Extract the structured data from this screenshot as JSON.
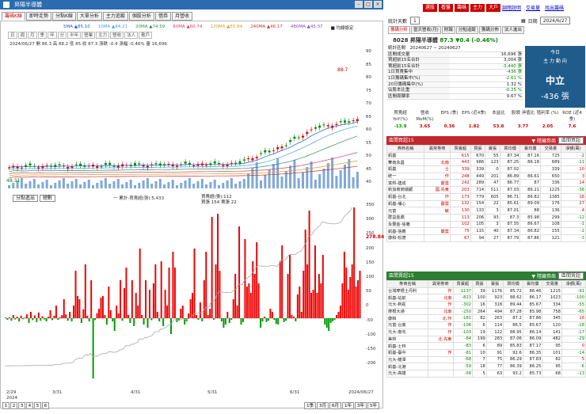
{
  "window": {
    "title": "昇陽半導體"
  },
  "chart_tabs": [
    "籌碼K線",
    "即時走勢",
    "分點K線",
    "大單分析",
    "主力追蹤",
    "個股分析",
    "借券",
    "月營收"
  ],
  "chart_toolbar": [
    "日",
    "週",
    "月",
    "季",
    "年",
    "分",
    "半年",
    "營業",
    "主力",
    "營收",
    "法人",
    "散戶"
  ],
  "ma": [
    {
      "label": "5MA",
      "value": "▲85.10",
      "color": "#2255cc"
    },
    {
      "label": "10MA",
      "value": "▲84.21",
      "color": "#4aa0d8"
    },
    {
      "label": "20MA",
      "value": "▲74.59",
      "color": "#2e8b57"
    },
    {
      "label": "60MA",
      "value": "▲60.74",
      "color": "#d04070"
    },
    {
      "label": "120MA",
      "value": "▲55.84",
      "color": "#d0a020"
    },
    {
      "label": "240MA",
      "value": "▲46.17",
      "color": "#cc3333"
    },
    {
      "label": "480MA",
      "value": "▲45.37",
      "color": "#8844cc"
    }
  ],
  "ma_note": "■ 均線設定",
  "price_info": "2024/06/27 開 86.3 高 88.2 低 85 收 87.3 漲跌 -0.4 漲幅 -0.46% 量 16,696",
  "price_info2": "元",
  "price_axis": [
    "90",
    "85",
    "80",
    "75",
    "70",
    "65",
    "60",
    "55",
    "50",
    "45",
    "40"
  ],
  "price_labels": {
    "high": "88.7",
    "low": "48.31"
  },
  "chip_axis": [
    "350",
    "300",
    "250",
    "200",
    "150",
    "100",
    "50",
    "0",
    "-50",
    "-100",
    "-150",
    "-200"
  ],
  "chip_select": "分點進出",
  "chip_select2": "總數",
  "chip_legend": "一 累計-買賣超(張):5,433",
  "chip_buy": "買賣超(張):112",
  "chip_sell": "買張 154 賣張 22",
  "chip_cum": "278.84",
  "x_labels": [
    {
      "t": "2/29",
      "t2": "2024"
    },
    {
      "t": "3/31",
      "t2": ""
    },
    {
      "t": "4/31",
      "t2": ""
    },
    {
      "t": "5/31",
      "t2": ""
    },
    {
      "t": "6/31",
      "t2": ""
    },
    {
      "t": "2024/06/27",
      "t2": ""
    }
  ],
  "bottom_pages": [
    "1",
    "2",
    "3",
    "4",
    "5",
    "6"
  ],
  "range_buttons": [
    "1季",
    "3月",
    "6月",
    "1年",
    "3年",
    "5年"
  ],
  "top_buttons": [
    "選股",
    "看盤",
    "籌碼",
    "主力",
    "大戶"
  ],
  "top_links": [
    "調閱說明",
    "交易量",
    "找出籌碼"
  ],
  "stat_days_label": "統計天數",
  "stat_days": "1",
  "date_label": "日期",
  "date": "2024/6/27",
  "sub_tabs": [
    "籌碼分析",
    "當天營收(月)",
    "財報",
    "分點追蹤",
    "籌碼分佈",
    "法人進出"
  ],
  "stock": {
    "code": "8028 昇陽半導體",
    "price": "87.3",
    "change": "▼0.4 (-0.46%)"
  },
  "summary_range": "統計區間　20240627 ~ 20240627",
  "summary": [
    {
      "k": "區間成交量",
      "v": "16,696 張"
    },
    {
      "k": "買超前15名合計",
      "v": "3,004 張"
    },
    {
      "k": "賣超前15名合計",
      "v": "-3,440 張"
    },
    {
      "k": "1日買賣集中",
      "v": "-436 張"
    },
    {
      "k": "1日籌碼集中(%)",
      "v": "-2.61 %"
    },
    {
      "k": "20日籌碼集中(%)",
      "v": "1.32 %"
    },
    {
      "k": "佔股本比重",
      "v": "-0.25 %"
    },
    {
      "k": "區間周轉率",
      "v": "9.67 %"
    }
  ],
  "today": {
    "t1": "今日",
    "t2": "主 力 動 向",
    "t3": "中立",
    "t4": "-436 張"
  },
  "metrics_h": [
    "買賣超 YoY(%)",
    "營收 MoM(%)",
    "EPS (季)",
    "EPS (近4季)",
    "本益比",
    "股價 淨值比",
    "殖利率 (%)",
    "ROE (近4季)"
  ],
  "metrics_v": [
    "-13.9",
    "3.65",
    "0.36",
    "1.82",
    "53.8",
    "3.77",
    "2.05",
    "7.6"
  ],
  "buy_hdr": "區間買超15",
  "buy_sel": "區間買超",
  "sell_hdr": "區間賣超15",
  "sell_sel": "區間賣超",
  "cols": [
    "券商名稱",
    "異常券商",
    "買賣超",
    "買張",
    "賣張",
    "買均價",
    "賣均價",
    "交易量",
    "淨額(萬)"
  ],
  "buy_rows": [
    [
      "凱基",
      "",
      "615",
      "670",
      "55",
      "87.34",
      "87.16",
      "725",
      "-2"
    ],
    [
      "華南永昌",
      "北南",
      "443",
      "986",
      "123",
      "87.25",
      "86.18",
      "689",
      "-11"
    ],
    [
      "凱基",
      "士",
      "339",
      "339",
      "0",
      "87.02",
      "",
      "339",
      "10"
    ],
    [
      "統一",
      "作",
      "248",
      "449",
      "201",
      "86.89",
      "86.61",
      "650",
      "3"
    ],
    [
      "富邦-建成",
      "慶雲",
      "242",
      "289",
      "47",
      "86.77",
      "87",
      "336",
      "14"
    ],
    [
      "新加坡商瑞銀",
      "國.先東",
      "203",
      "714",
      "511",
      "87.03",
      "86.21",
      "1225",
      "-36"
    ],
    [
      "凱基-台北",
      "作",
      "173",
      "779",
      "605",
      "86.71",
      "86.82",
      "1385",
      "16"
    ],
    [
      "凱基-埔心",
      "慶雲",
      "132",
      "154",
      "22",
      "85.61",
      "89.09",
      "176",
      "27"
    ],
    [
      "元富",
      "敏",
      "130",
      "133",
      "3",
      "87.01",
      "88",
      "136",
      "4"
    ],
    [
      "群益金鼎",
      "",
      "113",
      "206",
      "93",
      "87.3",
      "85.98",
      "299",
      "-12"
    ],
    [
      "永豐金-信義",
      "",
      "102",
      "105",
      "3",
      "87.55",
      "86.67",
      "108",
      "-1"
    ],
    [
      "凱基-信義",
      "慶雲",
      "75",
      "115",
      "40",
      "87.34",
      "86.82",
      "155",
      "-2"
    ],
    [
      "康和-松德",
      "",
      "67",
      "94",
      "27",
      "87.79",
      "87.86",
      "121",
      "-3"
    ]
  ],
  "sell_rows": [
    [
      "台灣摩根士丹利",
      "作",
      "-1137",
      "39",
      "1176",
      "85.72",
      "86.46",
      "1215",
      "-91"
    ],
    [
      "凱基-站前",
      "北南",
      "-823",
      "100",
      "923",
      "88.62",
      "86.17",
      "1023",
      "-100"
    ],
    [
      "元大-新莊",
      "作",
      "-302",
      "16",
      "318",
      "89.44",
      "85.67",
      "334",
      "-55"
    ],
    [
      "摩根大通",
      "北南",
      "-250",
      "264",
      "494",
      "87.28",
      "85.98",
      "758",
      "-65"
    ],
    [
      "康和",
      "北.作",
      "-181",
      "82",
      "263",
      "87.2",
      "87.86",
      "345",
      "16"
    ],
    [
      "元富-台南",
      "作",
      "-108",
      "6",
      "114",
      "86.5",
      "85.67",
      "120",
      "-18"
    ],
    [
      "元大-南屯",
      "作",
      "-103",
      "19",
      "122",
      "88.95",
      "86.14",
      "141",
      "-17"
    ],
    [
      "美林",
      "北.先東",
      "-84",
      "199",
      "283",
      "87.06",
      "86.09",
      "482",
      "-29"
    ],
    [
      "凱基-士林",
      "",
      "-83",
      "6",
      "89",
      "85.83",
      "87.17",
      "95",
      "0"
    ],
    [
      "凱基-臺中",
      "作",
      "-81",
      "10",
      "91",
      "92.6",
      "86.35",
      "101",
      "-14"
    ],
    [
      "元大-龍潭",
      "",
      "-68",
      "7",
      "75",
      "86.29",
      "87.83",
      "82",
      "5"
    ],
    [
      "凱基-北港",
      "",
      "-59",
      "18",
      "77",
      "86.39",
      "86.25",
      "95",
      "-6"
    ],
    [
      "元大-高雄",
      "",
      "-58",
      "5",
      "63",
      "93.2",
      "85.73",
      "68",
      "-13"
    ]
  ],
  "chart_data": {
    "type": "bar",
    "title": "",
    "x": [
      "2/29",
      "3/31",
      "4/31",
      "5/31",
      "6/31",
      "2024/06/27"
    ],
    "ylim": [
      -200,
      350
    ],
    "series": [
      {
        "name": "買賣超(張)",
        "values": [
          2,
          -5,
          3,
          -8,
          10,
          -4,
          5,
          -10,
          8,
          -3,
          2,
          12,
          -15,
          20,
          -6,
          9,
          -12,
          18,
          -8,
          6,
          -4,
          -10,
          5,
          25,
          -6,
          8,
          40,
          -5,
          3,
          10,
          60,
          12,
          -8,
          20,
          -10,
          40,
          150,
          70,
          60,
          -15,
          28,
          170,
          8,
          -10,
          120,
          -190,
          -6,
          16,
          30,
          65,
          70,
          10,
          -20,
          100,
          25,
          -10,
          -40,
          40,
          15,
          120,
          -8,
          95,
          160,
          10,
          -15,
          120,
          -25,
          80,
          40,
          220,
          10,
          -20,
          120,
          -30,
          90,
          -6,
          110,
          170,
          20,
          -10,
          180,
          -25,
          90,
          40,
          160,
          -50,
          210,
          160,
          -12,
          -8,
          30,
          40,
          -20,
          -10,
          15,
          60,
          80,
          220,
          10,
          -5,
          50,
          -10,
          120,
          210,
          10,
          30,
          320,
          -5,
          170,
          330,
          150,
          -10,
          -30,
          -20,
          20,
          -15,
          -5,
          60,
          140,
          40,
          290,
          -20,
          -12,
          250,
          100,
          110,
          80,
          180,
          140,
          240,
          110,
          -30,
          -10,
          5,
          -12,
          -8,
          30,
          20,
          -5,
          -18,
          -20,
          180,
          230,
          -12,
          -8,
          140,
          200,
          10,
          5,
          -10,
          75,
          100,
          20,
          150,
          280,
          170,
          340,
          80,
          90,
          230,
          80,
          140,
          110,
          200,
          -20,
          -30,
          -40,
          -15,
          -10,
          -5,
          10,
          20,
          40,
          110,
          210,
          160,
          90,
          130,
          170,
          380,
          100,
          120,
          150
        ]
      }
    ]
  }
}
